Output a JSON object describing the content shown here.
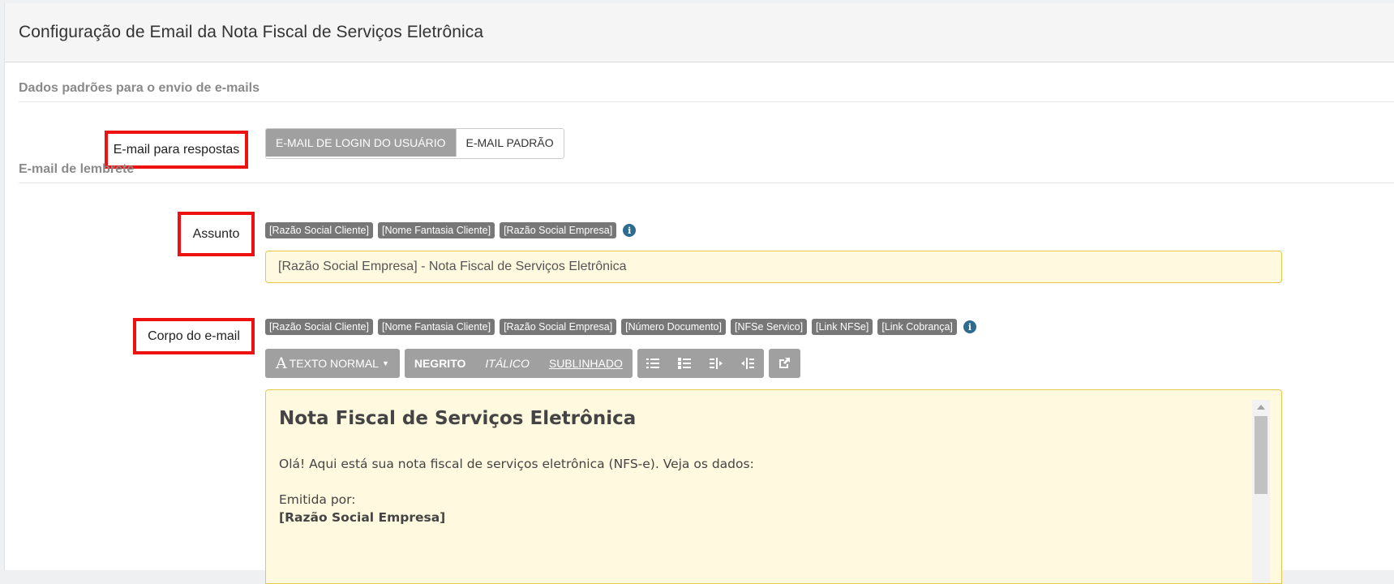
{
  "header": {
    "title": "Configuração de Email da Nota Fiscal de Serviços Eletrônica"
  },
  "sections": {
    "defaults_title": "Dados padrões para o envio de e-mails",
    "reminder_title": "E-mail de lembrete"
  },
  "reply_email": {
    "label": "E-mail para respostas",
    "options": [
      {
        "label": "E-mail de login do usuário",
        "active": true
      },
      {
        "label": "E-mail padrão",
        "active": false
      }
    ]
  },
  "subject": {
    "label": "Assunto",
    "tags": [
      "[Razão Social Cliente]",
      "[Nome Fantasia Cliente]",
      "[Razão Social Empresa]"
    ],
    "value": "[Razão Social Empresa] - Nota Fiscal de Serviços Eletrônica"
  },
  "body": {
    "label": "Corpo do e-mail",
    "tags": [
      "[Razão Social Cliente]",
      "[Nome Fantasia Cliente]",
      "[Razão Social Empresa]",
      "[Número Documento]",
      "[NFSe Servico]",
      "[Link NFSe]",
      "[Link Cobrança]"
    ],
    "toolbar": {
      "font_style": "Texto normal",
      "bold": "Negrito",
      "italic": "Itálico",
      "underline": "Sublinhado"
    },
    "content": {
      "heading": "Nota Fiscal de Serviços Eletrônica",
      "intro": "Olá! Aqui está sua nota fiscal de serviços eletrônica (NFS-e). Veja os dados:",
      "issued_by_label": "Emitida por:",
      "issued_by_value": "[Razão Social Empresa]"
    }
  },
  "colors": {
    "highlight_border": "#ee1111",
    "tag_bg": "#777777",
    "input_bg": "#fff9df",
    "input_border": "#e8c84a",
    "button_bg": "#a0a0a0"
  },
  "icons": {
    "info": "info-icon",
    "list_unordered": "list-unordered-icon",
    "list_ordered": "list-ordered-icon",
    "indent": "indent-icon",
    "outdent": "outdent-icon",
    "link": "share-link-icon"
  }
}
